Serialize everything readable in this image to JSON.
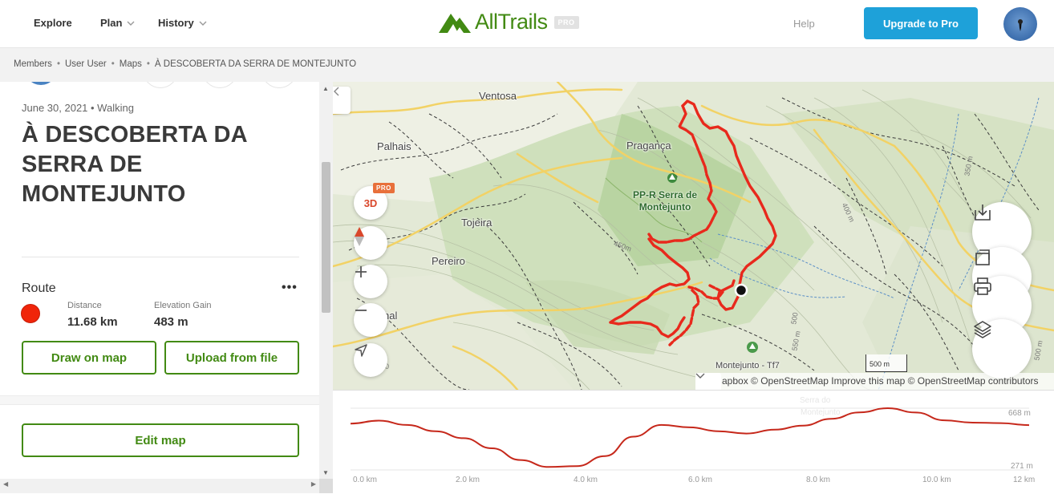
{
  "header": {
    "nav": [
      {
        "label": "Explore"
      },
      {
        "label": "Plan"
      },
      {
        "label": "History"
      }
    ],
    "logo_text": "AllTrails",
    "logo_badge": "PRO",
    "help_label": "Help",
    "upgrade_label": "Upgrade to Pro"
  },
  "breadcrumb": [
    "Members",
    "User User",
    "Maps",
    "À DESCOBERTA DA SERRA DE MONTEJUNTO"
  ],
  "sidebar": {
    "date_activity": "June 30, 2021 • Walking",
    "title": "À DESCOBERTA DA SERRA DE MONTEJUNTO",
    "route_heading": "Route",
    "menu_label": "•••",
    "distance_label": "Distance",
    "distance_value": "11.68 km",
    "elevation_label": "Elevation Gain",
    "elevation_value": "483 m",
    "draw_label": "Draw on map",
    "upload_label": "Upload from file",
    "edit_label": "Edit map"
  },
  "map": {
    "places": {
      "ventosa": "Ventosa",
      "palhais": "Palhais",
      "praganca": "Pragança",
      "park_line1": "PP-R Serra de",
      "park_line2": "Montejunto",
      "tojeira": "Tojeira",
      "pereiro": "Pereiro",
      "nal": "nal",
      "montejunto_tf7": "Montejunto - Tf7"
    },
    "contours": {
      "c450": "450m",
      "c400": "400 m",
      "c350": "350 m",
      "c550": "550 m",
      "c500": "500 m",
      "cnum": "500",
      "c60": "60"
    },
    "controls": {
      "three_d": "3D",
      "pro": "PRO"
    },
    "scale_label": "500 m",
    "attribution": "apbox © OpenStreetMap Improve this map © OpenStreetMap contributors",
    "route_color": "#e8291c"
  },
  "elevation": {
    "max_label": "668 m",
    "min_label": "271 m",
    "ghost_1": "Serra do",
    "ghost_2": "Montejunto",
    "x_labels": [
      "0.0 km",
      "2.0 km",
      "4.0 km",
      "6.0 km",
      "8.0 km",
      "10.0 km",
      "12 km"
    ],
    "profile_km": [
      0,
      0.5,
      1,
      1.5,
      2,
      2.5,
      3,
      3.5,
      4,
      4.5,
      5,
      5.5,
      6,
      6.5,
      7,
      7.5,
      8,
      8.5,
      9,
      9.5,
      10,
      10.5,
      11,
      11.5,
      12
    ],
    "profile_m": [
      569,
      588,
      560,
      520,
      475,
      410,
      335,
      290,
      295,
      360,
      485,
      560,
      545,
      520,
      505,
      530,
      556,
      600,
      641,
      668,
      640,
      590,
      575,
      572,
      559
    ]
  }
}
